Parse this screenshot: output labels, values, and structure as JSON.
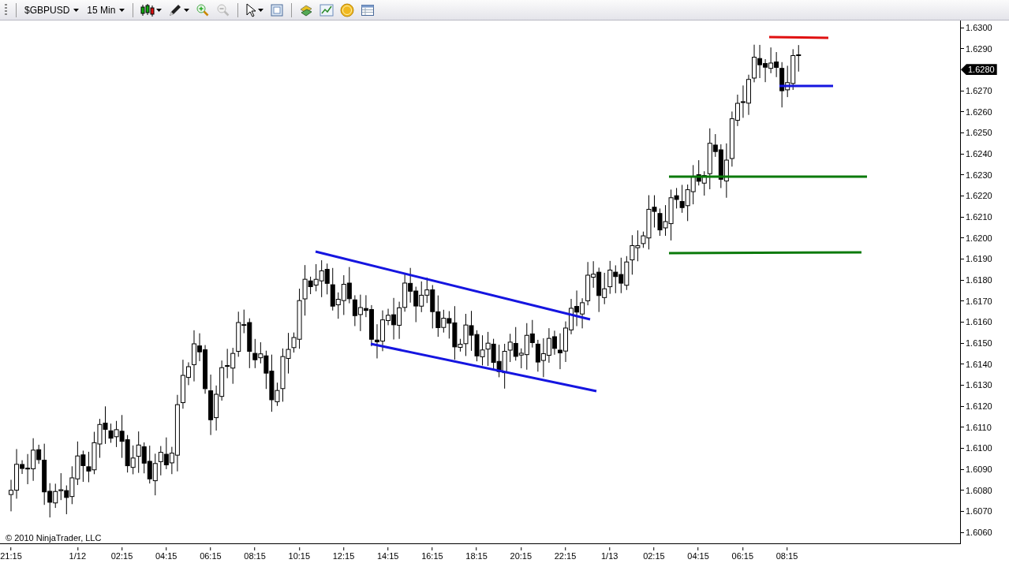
{
  "toolbar": {
    "instrument": "$GBPUSD",
    "interval": "15 Min"
  },
  "chart": {
    "copyright": "© 2010 NinjaTrader, LLC",
    "current_price": "1.6280"
  },
  "price_axis": {
    "labels": [
      "1.6300",
      "1.6290",
      "1.6270",
      "1.6260",
      "1.6250",
      "1.6240",
      "1.6230",
      "1.6220",
      "1.6210",
      "1.6200",
      "1.6190",
      "1.6180",
      "1.6170",
      "1.6160",
      "1.6150",
      "1.6140",
      "1.6130",
      "1.6120",
      "1.6110",
      "1.6100",
      "1.6090",
      "1.6080",
      "1.6070",
      "1.6060"
    ]
  },
  "time_axis": {
    "labels": [
      "21:15",
      "1/12",
      "02:15",
      "04:15",
      "06:15",
      "08:15",
      "10:15",
      "12:15",
      "14:15",
      "16:15",
      "18:15",
      "20:15",
      "22:15",
      "1/13",
      "02:15",
      "04:15",
      "06:15",
      "08:15"
    ]
  }
}
